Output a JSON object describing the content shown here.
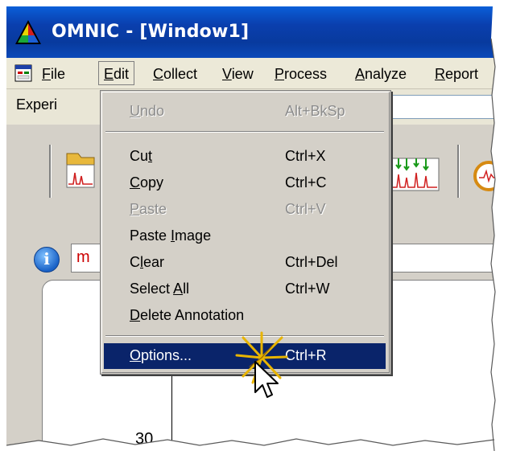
{
  "window": {
    "title": "OMNIC - [Window1]"
  },
  "menubar": {
    "items": [
      {
        "label": "File",
        "mnemonic": "F",
        "rest": "ile"
      },
      {
        "label": "Edit",
        "mnemonic": "E",
        "rest": "dit",
        "active": true
      },
      {
        "label": "Collect",
        "mnemonic": "C",
        "rest": "ollect"
      },
      {
        "label": "View",
        "mnemonic": "V",
        "rest": "iew"
      },
      {
        "label": "Process",
        "mnemonic": "P",
        "rest": "rocess"
      },
      {
        "label": "Analyze",
        "mnemonic": "A",
        "rest": "nalyze"
      },
      {
        "label": "Report",
        "mnemonic": "R",
        "rest": "eport"
      }
    ]
  },
  "experiment": {
    "label_visible": "Experi"
  },
  "info": {
    "text_visible": "m"
  },
  "spectrum": {
    "tick_label": "30"
  },
  "edit_menu": {
    "items": [
      {
        "pre": "",
        "mn": "U",
        "post": "ndo",
        "shortcut": "Alt+BkSp",
        "enabled": false
      },
      {
        "separator": true
      },
      {
        "pre": "Cu",
        "mn": "t",
        "post": "",
        "shortcut": "Ctrl+X",
        "enabled": true
      },
      {
        "pre": "",
        "mn": "C",
        "post": "opy",
        "shortcut": "Ctrl+C",
        "enabled": true
      },
      {
        "pre": "",
        "mn": "P",
        "post": "aste",
        "shortcut": "Ctrl+V",
        "enabled": false
      },
      {
        "pre": "Paste ",
        "mn": "I",
        "post": "mage",
        "shortcut": "",
        "enabled": true
      },
      {
        "pre": "C",
        "mn": "l",
        "post": "ear",
        "shortcut": "Ctrl+Del",
        "enabled": true
      },
      {
        "pre": "Select ",
        "mn": "A",
        "post": "ll",
        "shortcut": "Ctrl+W",
        "enabled": true
      },
      {
        "pre": "",
        "mn": "D",
        "post": "elete Annotation",
        "shortcut": "",
        "enabled": true
      },
      {
        "separator": true
      },
      {
        "pre": "",
        "mn": "O",
        "post": "ptions...",
        "shortcut": "Ctrl+R",
        "enabled": true,
        "highlighted": true
      }
    ]
  },
  "colors": {
    "titlebar": "#0a3fae",
    "menu_highlight": "#0a246a",
    "info_text": "#cc0000",
    "disabled_text": "#8c8c8c"
  },
  "icons": [
    "app-logo-icon",
    "window-menu-icon",
    "open-spectrum-icon",
    "peak-markers-icon",
    "collect-sample-icon",
    "info-icon",
    "click-sparkle-icon",
    "mouse-pointer-icon"
  ]
}
